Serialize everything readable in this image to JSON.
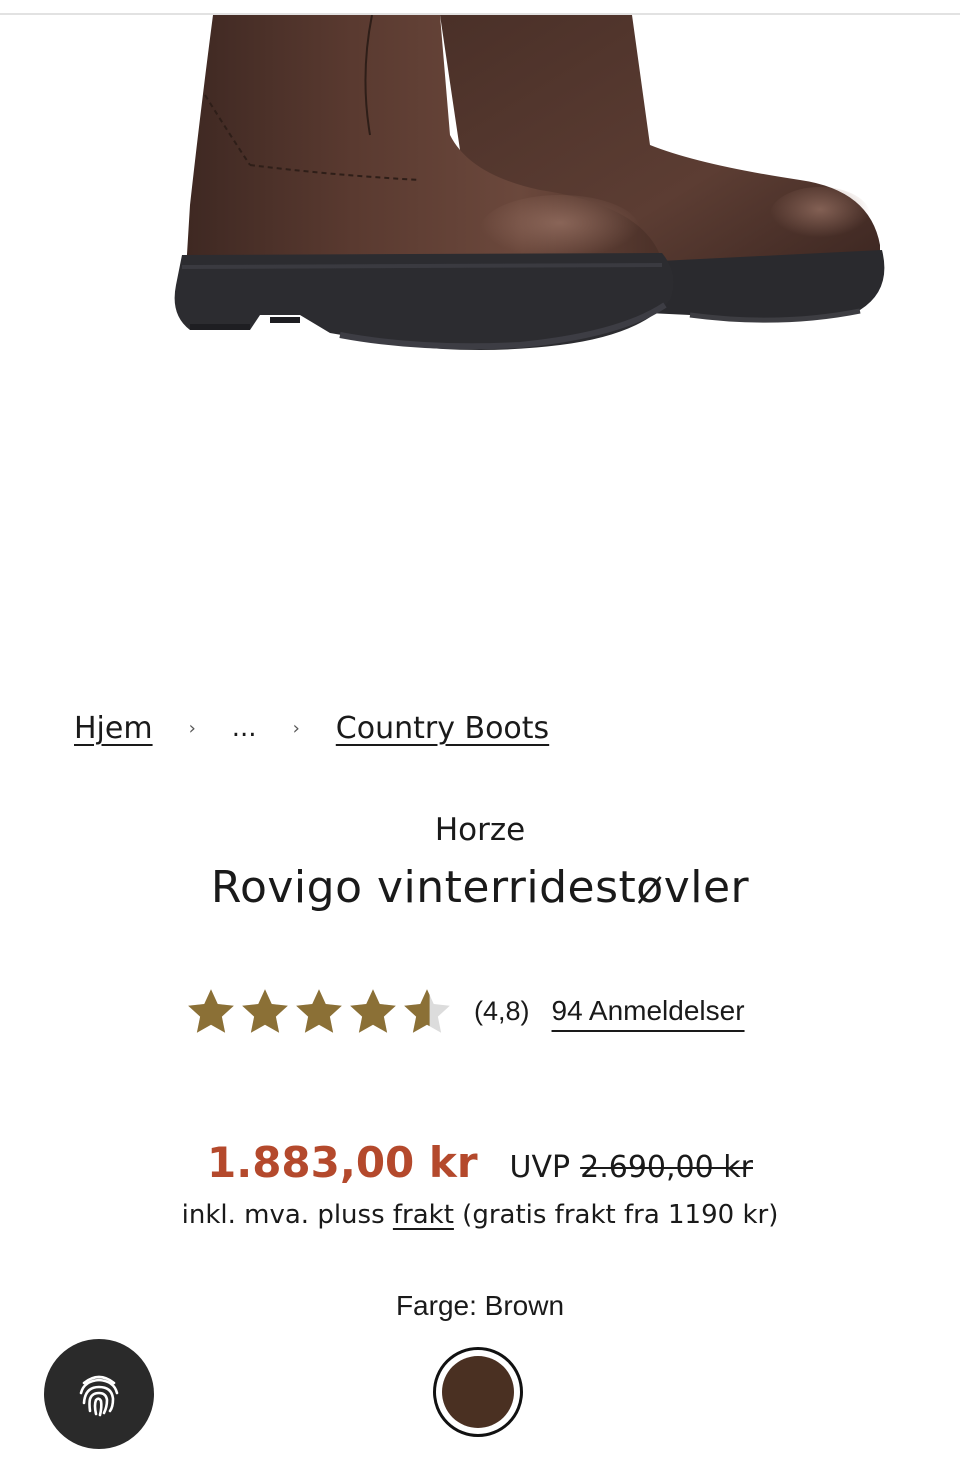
{
  "breadcrumb": {
    "home": "Hjem",
    "ellipsis": "...",
    "separator": "›",
    "category": "Country Boots"
  },
  "product": {
    "brand": "Horze",
    "title": "Rovigo vinterridestøvler"
  },
  "rating": {
    "value": "(4,8)",
    "score": 4.8,
    "max": 5,
    "reviews_label": "94 Anmeldelser",
    "star_color": "#8b7036"
  },
  "pricing": {
    "sale_price": "1.883,00 kr",
    "uvp_label": "UVP",
    "original_price": "2.690,00 kr",
    "sale_color": "#b4492c",
    "tax_prefix": "inkl. mva. pluss ",
    "tax_link": "frakt",
    "tax_suffix": " (gratis frakt fra 1190 kr)"
  },
  "color": {
    "label": "Farge: Brown",
    "swatch_color": "#4a3022"
  },
  "icons": {
    "star": "star-icon",
    "fingerprint": "fingerprint-icon"
  }
}
